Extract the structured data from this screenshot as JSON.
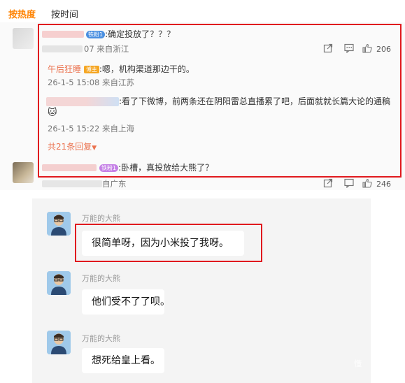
{
  "tabs": {
    "by_heat": "按热度",
    "by_time": "按时间"
  },
  "comment1": {
    "badge": "铁粉1",
    "text": ":确定投放了？？？",
    "meta": "07 来自浙江",
    "like_count": "206"
  },
  "reply1": {
    "username": "午后狂睡",
    "badge": "博主",
    "text": ":嗯，机构渠道那边干的。",
    "meta": "26-1-5 15:08 来自江苏"
  },
  "reply2": {
    "text": ":看了下微博，前两条还在阴阳雷总直播累了吧，后面就就长篇大论的通稿",
    "emoji": "🐱",
    "meta": "26-1-5 15:22 来自上海"
  },
  "more_replies": "共21条回复",
  "comment2": {
    "badge": "铁粉1",
    "text": ":卧槽，真投放给大熊了？",
    "meta": "自广东",
    "like_count": "246"
  },
  "chat": {
    "messages": [
      {
        "sender": "万能的大熊",
        "text": "很简单呀，因为小米投了我呀。"
      },
      {
        "sender": "万能的大熊",
        "text": "他们受不了了呗。"
      },
      {
        "sender": "万能的大熊",
        "text": "想死给皇上看。"
      }
    ],
    "watermark": "懂"
  },
  "colors": {
    "accent_orange": "#ff8200",
    "username": "#eb7350",
    "highlight_red": "#e0191e"
  }
}
